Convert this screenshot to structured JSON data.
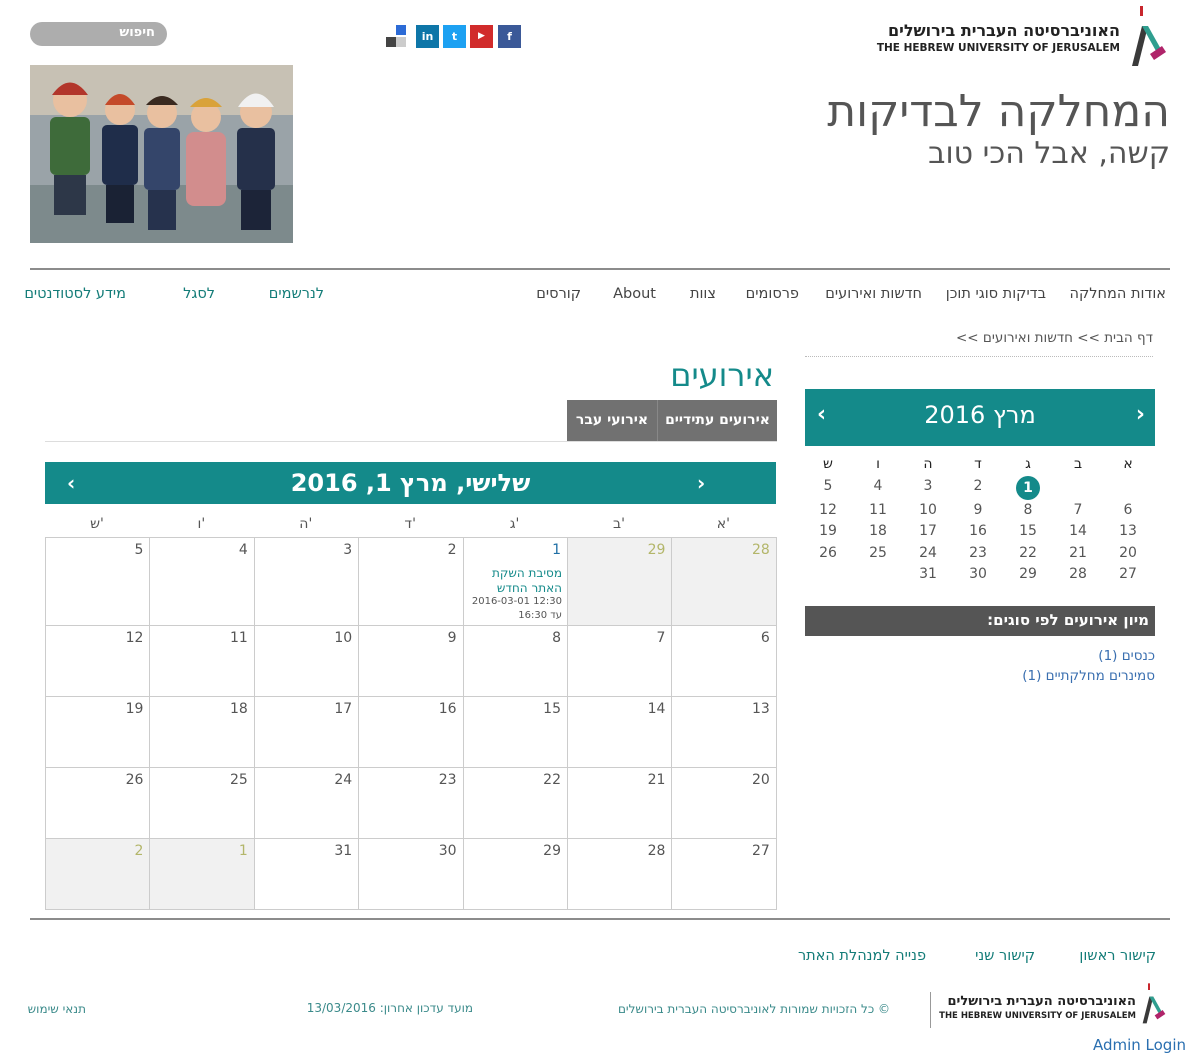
{
  "header": {
    "search_label": "חיפוש",
    "social": [
      {
        "name": "facebook",
        "glyph": "f",
        "color": "#3b5998"
      },
      {
        "name": "youtube",
        "glyph": "▶",
        "color": "#d12b2b"
      },
      {
        "name": "twitter",
        "glyph": "t",
        "color": "#1da1f2"
      },
      {
        "name": "linkedin",
        "glyph": "in",
        "color": "#0e76a8"
      }
    ],
    "logo_he": "האוניברסיטה העברית בירושלים",
    "logo_en": "THE HEBREW UNIVERSITY OF JERUSALEM",
    "site_title": "המחלקה לבדיקות",
    "site_subtitle": "קשה, אבל הכי טוב"
  },
  "nav": {
    "main": [
      "אודות המחלקה",
      "בדיקות סוגי תוכן",
      "חדשות ואירועים",
      "פרסומים",
      "צוות",
      "About",
      "קורסים"
    ],
    "secondary": [
      "לנרשמים",
      "לסגל",
      "מידע לסטודנטים"
    ]
  },
  "breadcrumb": {
    "home": "דף הבית",
    "current": "חדשות ואירועים",
    "sep": ">>"
  },
  "mini_calendar": {
    "title": "מרץ 2016",
    "days": [
      "א",
      "ב",
      "ג",
      "ד",
      "ה",
      "ו",
      "ש"
    ],
    "weeks": [
      [
        "",
        "",
        "1",
        "2",
        "3",
        "4",
        "5"
      ],
      [
        "6",
        "7",
        "8",
        "9",
        "10",
        "11",
        "12"
      ],
      [
        "13",
        "14",
        "15",
        "16",
        "17",
        "18",
        "19"
      ],
      [
        "20",
        "21",
        "22",
        "23",
        "24",
        "25",
        "26"
      ],
      [
        "27",
        "28",
        "29",
        "30",
        "31",
        "",
        ""
      ]
    ],
    "today": "1"
  },
  "event_types": {
    "title": "מיון אירועים לפי סוגים:",
    "items": [
      "כנסים (1)",
      "סמינרים מחלקתיים (1)"
    ]
  },
  "events": {
    "title": "אירועים",
    "tabs": [
      "אירועים עתידיים",
      "אירועי עבר"
    ],
    "day_title": "שלישי, מרץ 1, 2016",
    "days": [
      "א'",
      "ב'",
      "ג'",
      "ד'",
      "ה'",
      "ו'",
      "ש'"
    ],
    "weeks": [
      [
        "28",
        "29",
        "1",
        "2",
        "3",
        "4",
        "5"
      ],
      [
        "6",
        "7",
        "8",
        "9",
        "10",
        "11",
        "12"
      ],
      [
        "13",
        "14",
        "15",
        "16",
        "17",
        "18",
        "19"
      ],
      [
        "20",
        "21",
        "22",
        "23",
        "24",
        "25",
        "26"
      ],
      [
        "27",
        "28",
        "29",
        "30",
        "31",
        "1",
        "2"
      ]
    ],
    "event": {
      "title": "מסיבת השקת האתר החדש",
      "time": "2016-03-01 12:30",
      "until": "עד 16:30"
    }
  },
  "footer": {
    "links": [
      "קישור ראשון",
      "קישור שני",
      "פנייה למנהלת האתר"
    ],
    "copyright": "© כל הזכויות שמורות לאוניברסיטה העברית בירושלים",
    "updated": "מועד עדכון אחרון: 13/03/2016",
    "terms": "תנאי שימוש",
    "logo_he": "האוניברסיטה העברית בירושלים",
    "logo_en": "THE HEBREW UNIVERSITY OF JERUSALEM",
    "admin": "Admin Login"
  },
  "colors": {
    "teal": "#148a8a",
    "grey": "#555555"
  }
}
